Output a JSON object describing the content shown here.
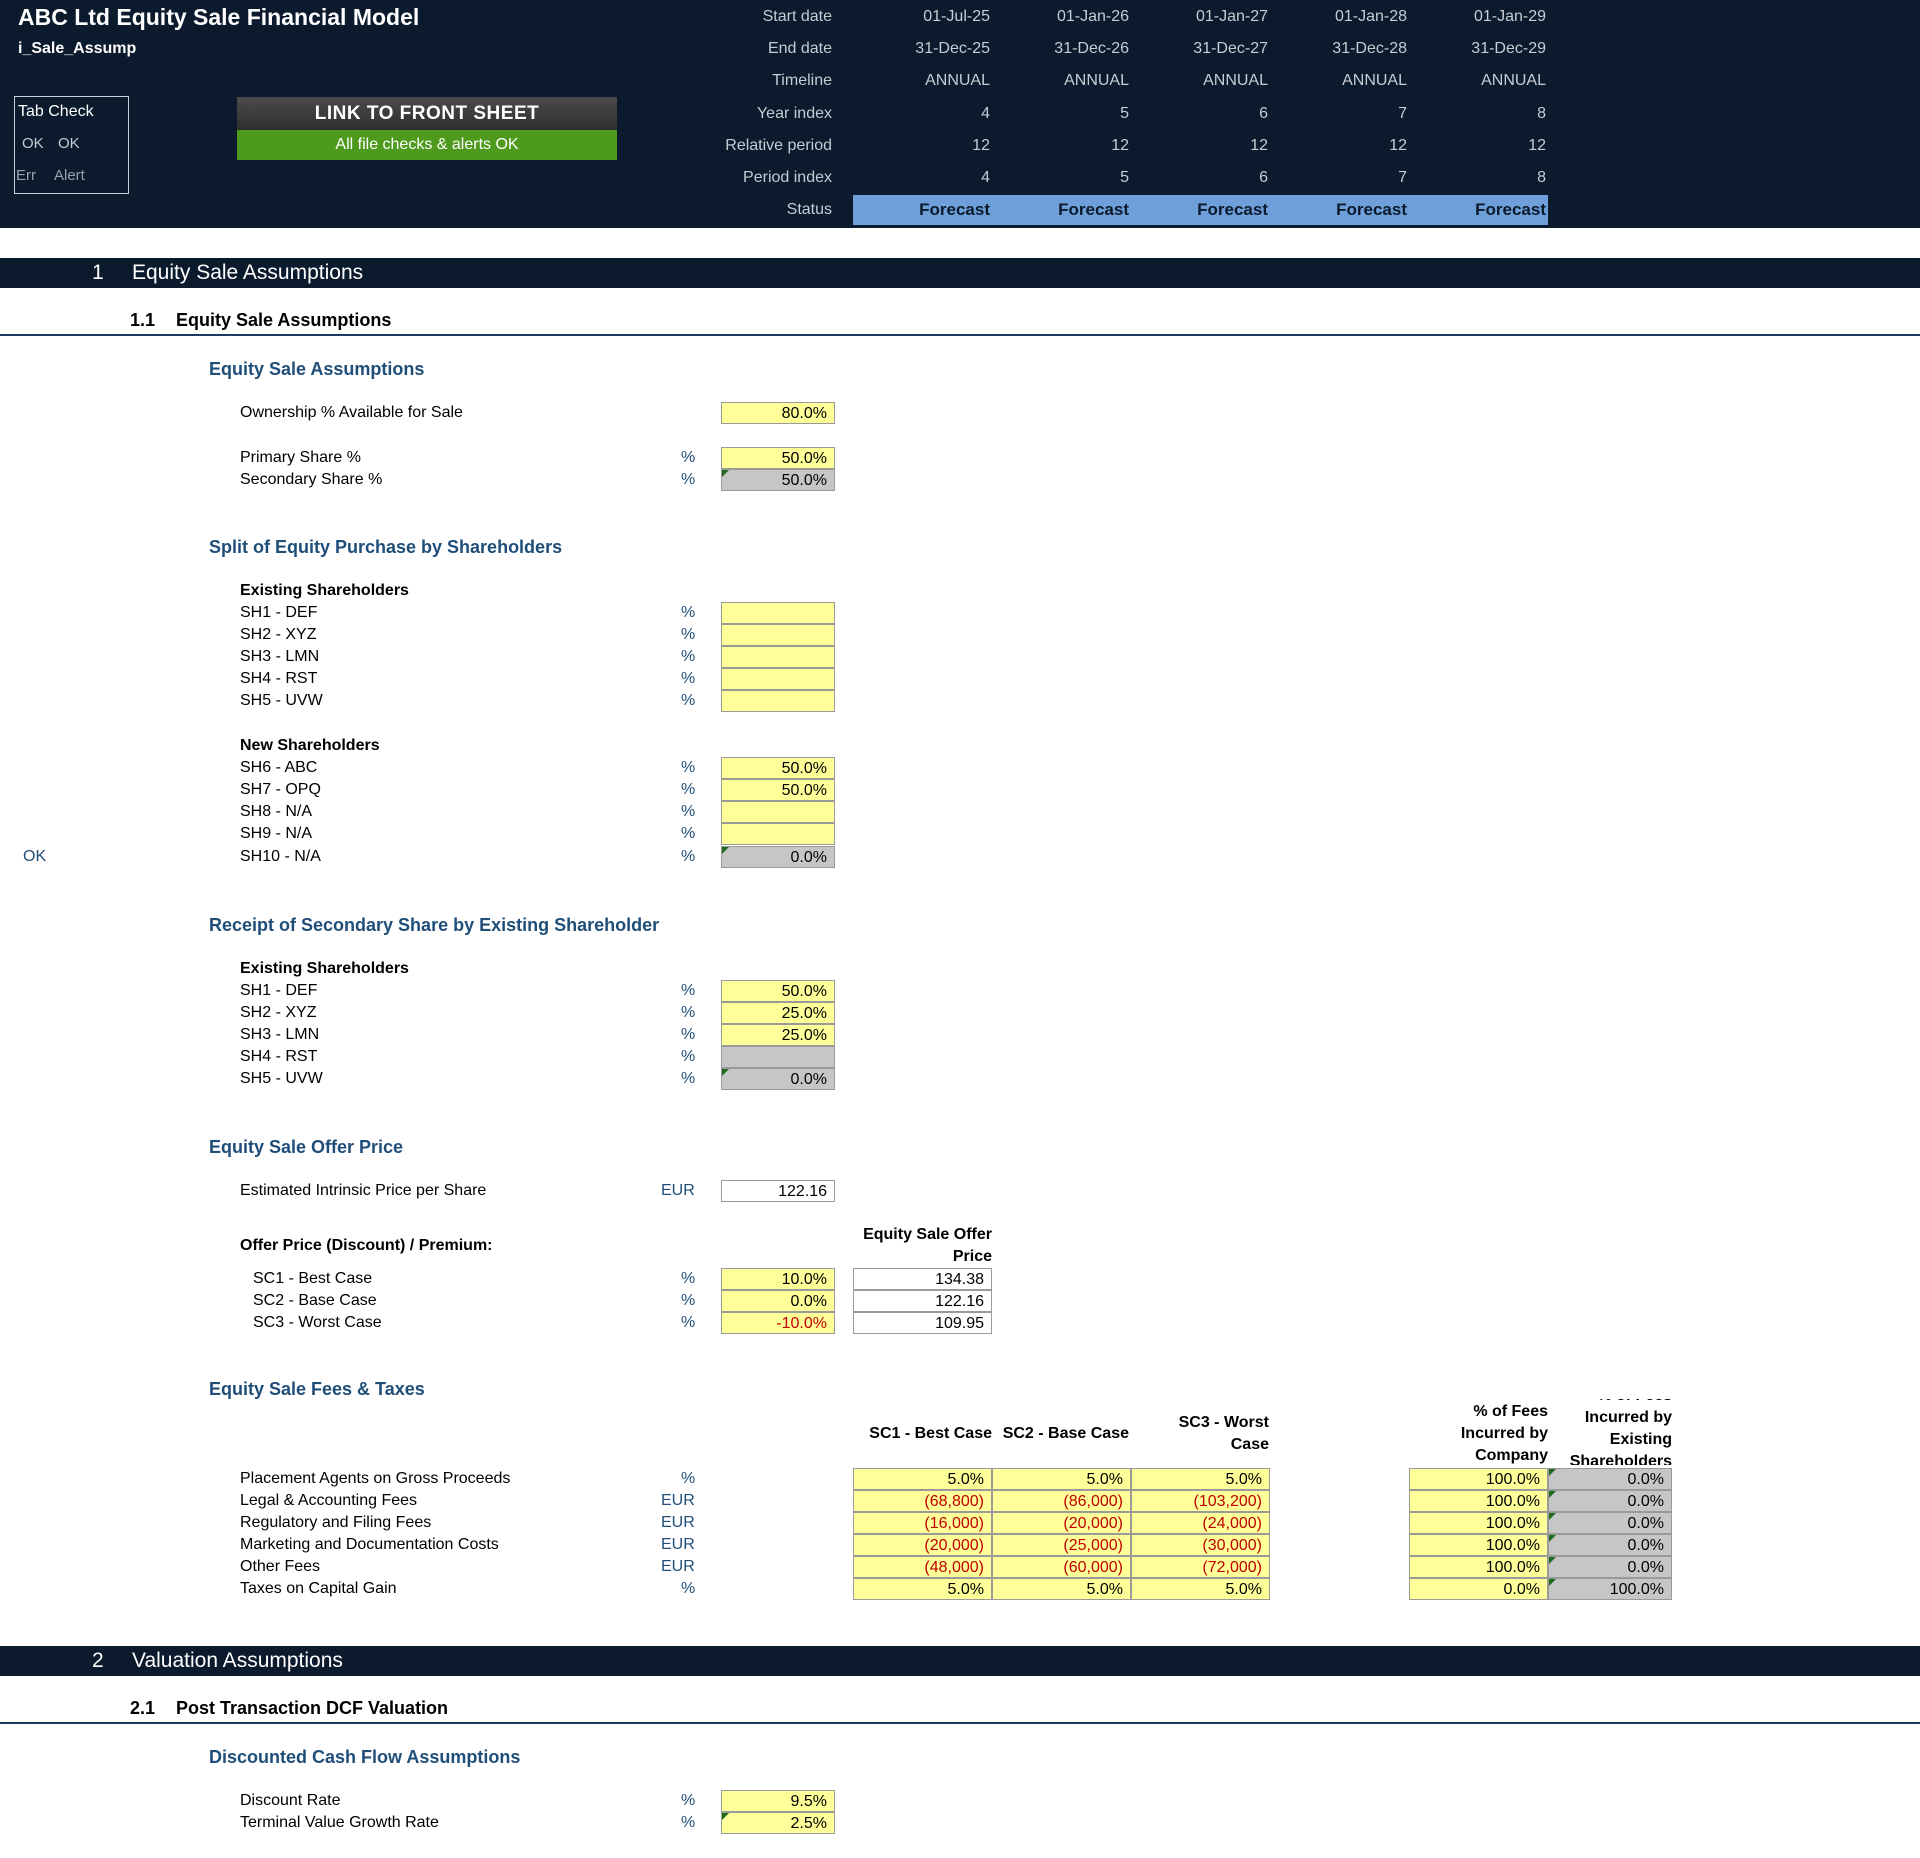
{
  "header": {
    "title": "ABC Ltd Equity Sale Financial Model",
    "sheet": "i_Sale_Assump",
    "tab_check": {
      "title": "Tab Check",
      "ok1": "OK",
      "ok2": "OK",
      "err": "Err",
      "alert": "Alert"
    },
    "link_button": "LINK TO FRONT SHEET",
    "checks_status": "All file checks & alerts OK",
    "timeline_labels": [
      "Start date",
      "End date",
      "Timeline",
      "Year index",
      "Relative period",
      "Period index",
      "Status"
    ],
    "periods": [
      {
        "start": "01-Jul-25",
        "end": "31-Dec-25",
        "timeline": "ANNUAL",
        "year_index": "4",
        "relative_period": "12",
        "period_index": "4",
        "status": "Forecast"
      },
      {
        "start": "01-Jan-26",
        "end": "31-Dec-26",
        "timeline": "ANNUAL",
        "year_index": "5",
        "relative_period": "12",
        "period_index": "5",
        "status": "Forecast"
      },
      {
        "start": "01-Jan-27",
        "end": "31-Dec-27",
        "timeline": "ANNUAL",
        "year_index": "6",
        "relative_period": "12",
        "period_index": "6",
        "status": "Forecast"
      },
      {
        "start": "01-Jan-28",
        "end": "31-Dec-28",
        "timeline": "ANNUAL",
        "year_index": "7",
        "relative_period": "12",
        "period_index": "7",
        "status": "Forecast"
      },
      {
        "start": "01-Jan-29",
        "end": "31-Dec-29",
        "timeline": "ANNUAL",
        "year_index": "8",
        "relative_period": "12",
        "period_index": "8",
        "status": "Forecast"
      }
    ]
  },
  "section1": {
    "num": "1",
    "title": "Equity Sale Assumptions"
  },
  "sub11": {
    "num": "1.1",
    "title": "Equity Sale Assumptions"
  },
  "esa": {
    "title": "Equity Sale Assumptions",
    "ownership": {
      "label": "Ownership % Available for Sale",
      "value": "80.0%"
    },
    "primary": {
      "label": "Primary Share %",
      "unit": "%",
      "value": "50.0%"
    },
    "secondary": {
      "label": "Secondary Share %",
      "unit": "%",
      "value": "50.0%"
    }
  },
  "split": {
    "title": "Split of Equity Purchase by Shareholders",
    "existing_head": "Existing Shareholders",
    "existing": [
      {
        "label": "SH1 - DEF",
        "unit": "%",
        "value": ""
      },
      {
        "label": "SH2 - XYZ",
        "unit": "%",
        "value": ""
      },
      {
        "label": "SH3 - LMN",
        "unit": "%",
        "value": ""
      },
      {
        "label": "SH4 - RST",
        "unit": "%",
        "value": ""
      },
      {
        "label": "SH5 - UVW",
        "unit": "%",
        "value": ""
      }
    ],
    "new_head": "New Shareholders",
    "new": [
      {
        "label": "SH6 - ABC",
        "unit": "%",
        "value": "50.0%"
      },
      {
        "label": "SH7 - OPQ",
        "unit": "%",
        "value": "50.0%"
      },
      {
        "label": "SH8 - N/A",
        "unit": "%",
        "value": ""
      },
      {
        "label": "SH9 - N/A",
        "unit": "%",
        "value": ""
      },
      {
        "label": "SH10 - N/A",
        "unit": "%",
        "value": "0.0%"
      }
    ],
    "check_flag": "OK"
  },
  "receipt": {
    "title": "Receipt of Secondary Share by Existing Shareholder",
    "head": "Existing Shareholders",
    "rows": [
      {
        "label": "SH1 - DEF",
        "unit": "%",
        "value": "50.0%"
      },
      {
        "label": "SH2 - XYZ",
        "unit": "%",
        "value": "25.0%"
      },
      {
        "label": "SH3 - LMN",
        "unit": "%",
        "value": "25.0%"
      },
      {
        "label": "SH4 - RST",
        "unit": "%",
        "value": ""
      },
      {
        "label": "SH5 - UVW",
        "unit": "%",
        "value": "0.0%"
      }
    ]
  },
  "offer": {
    "title": "Equity Sale Offer Price",
    "intrinsic": {
      "label": "Estimated Intrinsic Price per Share",
      "unit": "EUR",
      "value": "122.16"
    },
    "discount_label": "Offer Price (Discount) / Premium:",
    "col_head": "Equity Sale Offer Price",
    "rows": [
      {
        "label": "SC1 - Best Case",
        "unit": "%",
        "pct": "10.0%",
        "price": "134.38"
      },
      {
        "label": "SC2 - Base Case",
        "unit": "%",
        "pct": "0.0%",
        "price": "122.16"
      },
      {
        "label": "SC3 - Worst Case",
        "unit": "%",
        "pct": "-10.0%",
        "price": "109.95"
      }
    ]
  },
  "fees": {
    "title": "Equity Sale Fees & Taxes",
    "col_sc1": "SC1 - Best Case",
    "col_sc2": "SC2 - Base Case",
    "col_sc3": "SC3 - Worst Case",
    "col_company": "% of Fees Incurred by Company",
    "col_existing": "% of Fees Incurred by Existing Shareholders",
    "rows": [
      {
        "label": "Placement Agents on Gross Proceeds",
        "unit": "%",
        "sc1": "5.0%",
        "sc2": "5.0%",
        "sc3": "5.0%",
        "company": "100.0%",
        "existing": "0.0%"
      },
      {
        "label": "Legal & Accounting Fees",
        "unit": "EUR",
        "sc1": "(68,800)",
        "sc2": "(86,000)",
        "sc3": "(103,200)",
        "company": "100.0%",
        "existing": "0.0%"
      },
      {
        "label": "Regulatory and Filing Fees",
        "unit": "EUR",
        "sc1": "(16,000)",
        "sc2": "(20,000)",
        "sc3": "(24,000)",
        "company": "100.0%",
        "existing": "0.0%"
      },
      {
        "label": "Marketing and Documentation Costs",
        "unit": "EUR",
        "sc1": "(20,000)",
        "sc2": "(25,000)",
        "sc3": "(30,000)",
        "company": "100.0%",
        "existing": "0.0%"
      },
      {
        "label": "Other Fees",
        "unit": "EUR",
        "sc1": "(48,000)",
        "sc2": "(60,000)",
        "sc3": "(72,000)",
        "company": "100.0%",
        "existing": "0.0%"
      },
      {
        "label": "Taxes on Capital Gain",
        "unit": "%",
        "sc1": "5.0%",
        "sc2": "5.0%",
        "sc3": "5.0%",
        "company": "0.0%",
        "existing": "100.0%"
      }
    ]
  },
  "section2": {
    "num": "2",
    "title": "Valuation Assumptions"
  },
  "sub21": {
    "num": "2.1",
    "title": "Post Transaction DCF Valuation"
  },
  "dcf": {
    "title": "Discounted Cash Flow Assumptions",
    "discount": {
      "label": "Discount Rate",
      "unit": "%",
      "value": "9.5%"
    },
    "growth": {
      "label": "Terminal Value Growth Rate",
      "unit": "%",
      "value": "2.5%"
    }
  },
  "colors": {
    "header_bg": "#0b1a2c",
    "input_yellow": "#ffff99",
    "calc_grey": "#c6c6c6",
    "forecast_blue": "#6f9fd8",
    "ok_green": "#4e9a1c",
    "title_blue": "#1f4e79",
    "negative_red": "#c00000"
  }
}
